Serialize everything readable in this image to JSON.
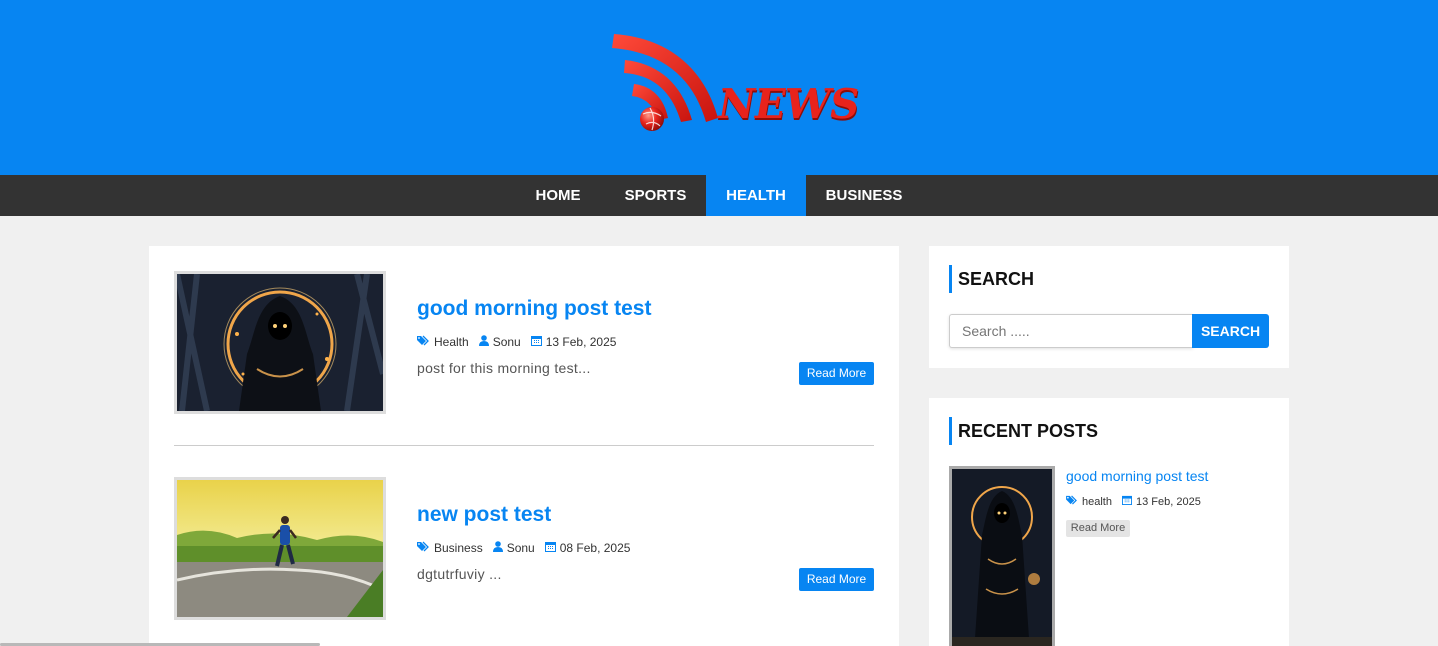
{
  "brand": {
    "logo_text": "NEWS",
    "colors": {
      "primary": "#0785f2",
      "nav_bg": "#333333",
      "logo_red": "#e8231c"
    }
  },
  "nav": {
    "items": [
      {
        "label": "HOME",
        "active": false
      },
      {
        "label": "SPORTS",
        "active": false
      },
      {
        "label": "HEALTH",
        "active": true
      },
      {
        "label": "BUSINESS",
        "active": false
      }
    ]
  },
  "posts": [
    {
      "title": "good morning post test",
      "category": "Health",
      "author": "Sonu",
      "date": "13 Feb, 2025",
      "excerpt": "post for this morning test...",
      "read_more": "Read More",
      "image": "hooded-figure-image"
    },
    {
      "title": "new post test",
      "category": "Business",
      "author": "Sonu",
      "date": "08 Feb, 2025",
      "excerpt": "dgtutrfuviy ...",
      "read_more": "Read More",
      "image": "runner-image"
    }
  ],
  "sidebar": {
    "search": {
      "heading": "SEARCH",
      "placeholder": "Search .....",
      "button": "SEARCH"
    },
    "recent": {
      "heading": "RECENT POSTS",
      "items": [
        {
          "title": "good morning post test",
          "category": "health",
          "date": "13 Feb, 2025",
          "read_more": "Read More"
        }
      ]
    }
  },
  "icons": {
    "category": "tags-icon",
    "author": "user-icon",
    "date": "calendar-icon"
  }
}
